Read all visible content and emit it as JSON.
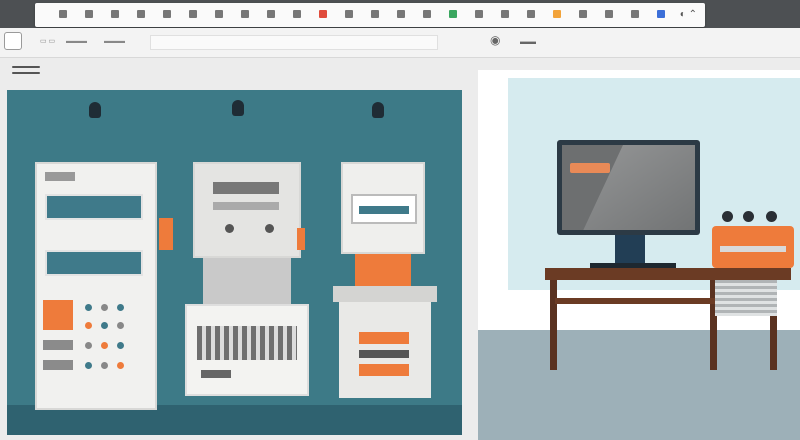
{
  "toolbar": {
    "icons": [
      "back-icon",
      "forward-icon",
      "grid-icon",
      "folder-icon",
      "tag-icon",
      "star-icon",
      "list-icon",
      "ruler-icon",
      "table-icon",
      "pen-icon",
      "color-icon",
      "align-icon",
      "text-icon",
      "paint-icon",
      "flask-icon",
      "crop-icon",
      "arrow-icon",
      "box-icon",
      "image-icon",
      "film-icon",
      "chart-icon",
      "flag-icon",
      "view-icon",
      "settings-icon"
    ],
    "accent_colors": [
      "#e04c3c",
      "#f2a33a",
      "#3aa65f",
      "#3c6fd8"
    ]
  },
  "subbar": {
    "home_icon": "home-icon",
    "tab_icons": [
      "tab-icon-1",
      "tab-icon-2",
      "tab-icon-3",
      "tab-icon-4"
    ],
    "right_icon": "camera-icon"
  },
  "scene": {
    "left_panel_color": "#3d7a87",
    "accent_orange": "#ee7b3b",
    "wall_color": "#d6ebef",
    "desk_color": "#6b3b24",
    "monitor_frame": "#2c3a45"
  }
}
